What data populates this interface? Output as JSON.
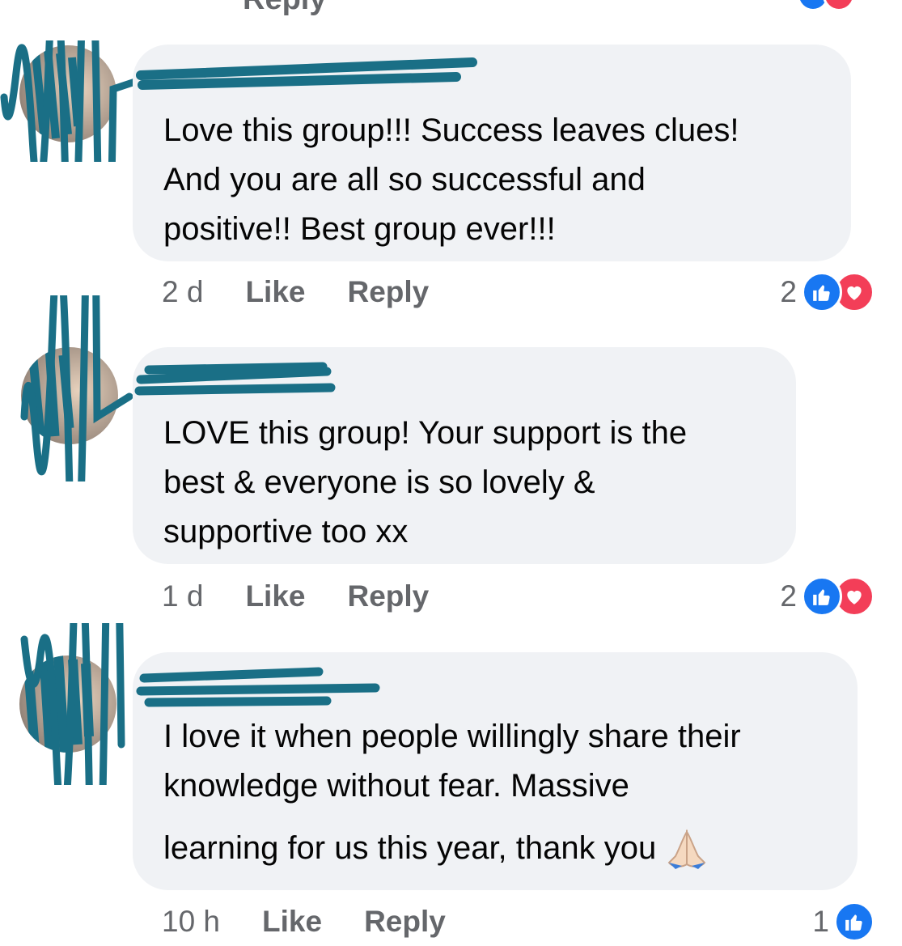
{
  "top_remnant": {
    "reply_label": "Reply"
  },
  "comments": [
    {
      "lines": [
        "Love this group!!! Success leaves clues!",
        "And you are all so successful and",
        "positive!! Best group ever!!!"
      ],
      "time": "2 d",
      "like_label": "Like",
      "reply_label": "Reply",
      "reaction_count": "2",
      "reactions": [
        "like-icon",
        "love-icon"
      ]
    },
    {
      "lines": [
        "LOVE this group! Your support is the",
        "best & everyone is so lovely &",
        "supportive too xx"
      ],
      "time": "1 d",
      "like_label": "Like",
      "reply_label": "Reply",
      "reaction_count": "2",
      "reactions": [
        "like-icon",
        "love-icon"
      ]
    },
    {
      "lines": [
        "I love it when people willingly share their",
        "knowledge without fear. Massive",
        "learning for us this year, thank you"
      ],
      "time": "10 h",
      "like_label": "Like",
      "reply_label": "Reply",
      "reaction_count": "1",
      "reactions": [
        "like-icon"
      ]
    }
  ],
  "colors": {
    "bubble": "#f0f2f5",
    "meta_text": "#65676b",
    "body_text": "#050505",
    "like_blue": "#1877f2",
    "love_red": "#f33e58",
    "redaction_teal": "#1a6f86"
  },
  "icons": [
    "like-icon",
    "love-icon",
    "folded-hands-emoji-icon"
  ]
}
